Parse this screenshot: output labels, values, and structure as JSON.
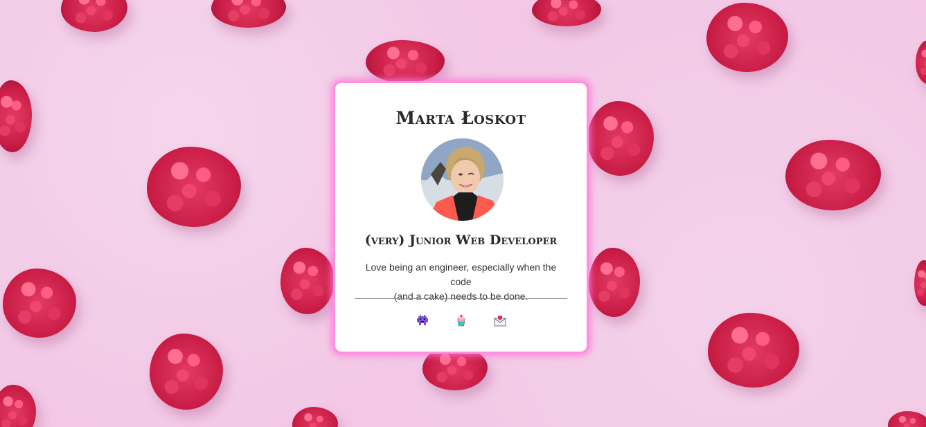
{
  "profile": {
    "name": "Marta Łoskot",
    "role": "(very) Junior Web Developer",
    "bio_line1": "Love being an engineer, especially when the code",
    "bio_line2": "(and a cake) needs to be done."
  },
  "links": [
    {
      "icon": "alien-monster-icon"
    },
    {
      "icon": "cupcake-icon"
    },
    {
      "icon": "envelope-heart-icon"
    }
  ],
  "colors": {
    "background": "#f2c8e6",
    "card_glow": "#ff8fe0",
    "raspberry": "#d62a55"
  }
}
